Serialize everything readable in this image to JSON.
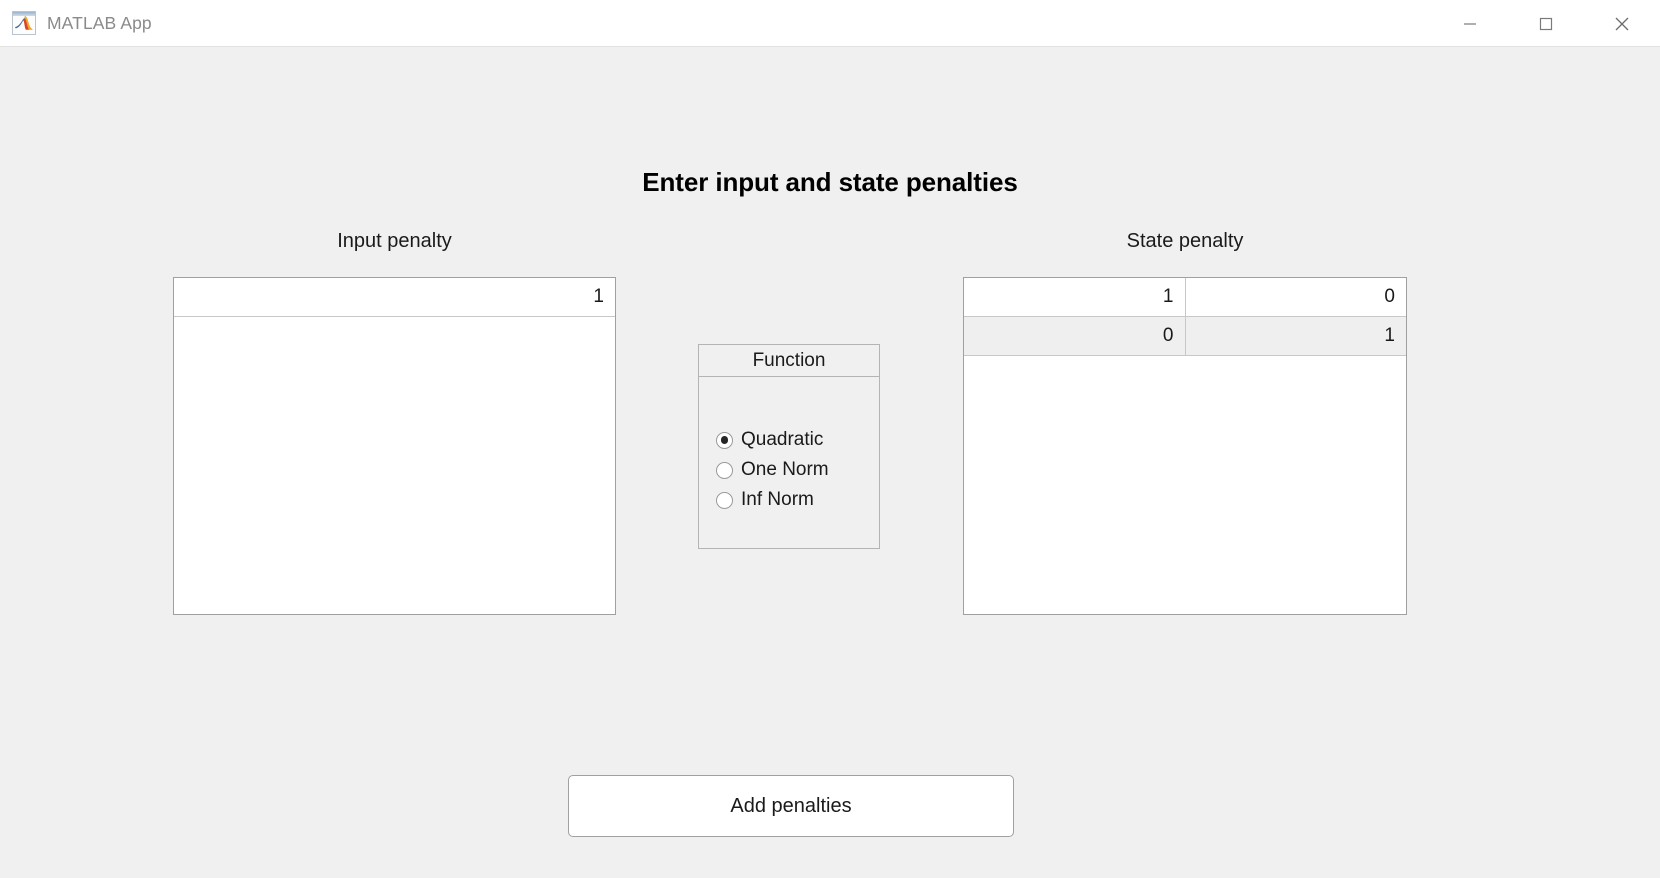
{
  "window": {
    "title": "MATLAB App",
    "icon": "matlab-membrane-icon",
    "controls": {
      "minimize": "minimize-icon",
      "maximize": "maximize-icon",
      "close": "close-icon"
    }
  },
  "main": {
    "heading": "Enter input and state penalties",
    "input_penalty": {
      "label": "Input penalty",
      "rows": [
        [
          "1"
        ]
      ]
    },
    "state_penalty": {
      "label": "State penalty",
      "rows": [
        [
          "1",
          "0"
        ],
        [
          "0",
          "1"
        ]
      ]
    },
    "function_panel": {
      "title": "Function",
      "options": [
        {
          "label": "Quadratic",
          "selected": true
        },
        {
          "label": "One Norm",
          "selected": false
        },
        {
          "label": "Inf Norm",
          "selected": false
        }
      ]
    },
    "action_button": {
      "label": "Add penalties"
    }
  },
  "colors": {
    "background": "#f0f0f0",
    "titlebar": "#ffffff",
    "table_border": "#a0a0a0",
    "grid_line": "#c8c8c8",
    "row_stripe": "#efefef",
    "text": "#1a1a1a",
    "title_text": "#8a8a8a"
  }
}
